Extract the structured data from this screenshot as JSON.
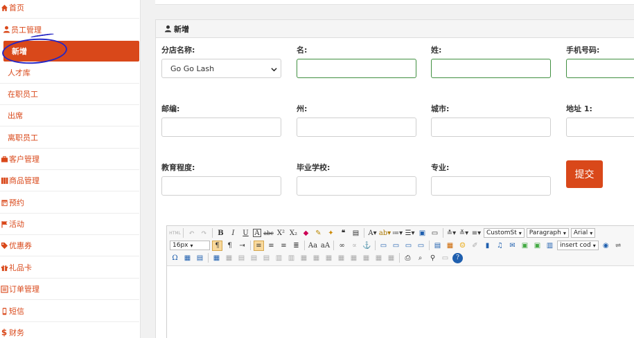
{
  "sidebar": {
    "items": [
      {
        "label": "首页",
        "icon": "home-icon"
      },
      {
        "label": "员工管理",
        "icon": "user-icon",
        "children": [
          {
            "label": "新增",
            "active": true
          },
          {
            "label": "人才库"
          },
          {
            "label": "在职员工"
          },
          {
            "label": "出席"
          },
          {
            "label": "离职员工"
          }
        ]
      },
      {
        "label": "客户管理",
        "icon": "briefcase-icon"
      },
      {
        "label": "商品管理",
        "icon": "grid-icon"
      },
      {
        "label": "预约",
        "icon": "calendar-icon"
      },
      {
        "label": "活动",
        "icon": "flag-icon"
      },
      {
        "label": "优惠券",
        "icon": "tag-icon"
      },
      {
        "label": "礼品卡",
        "icon": "gift-icon"
      },
      {
        "label": "订单管理",
        "icon": "list-icon"
      },
      {
        "label": "短信",
        "icon": "mobile-icon"
      },
      {
        "label": "财务",
        "icon": "dollar-icon"
      }
    ]
  },
  "panel": {
    "title": "新增"
  },
  "form": {
    "store_label": "分店名称:",
    "store_value": "Go Go Lash",
    "first_name_label": "名:",
    "last_name_label": "姓:",
    "phone_label": "手机号码:",
    "zip_label": "邮编:",
    "state_label": "州:",
    "city_label": "城市:",
    "address_label": "地址 1:",
    "education_label": "教育程度:",
    "school_label": "毕业学校:",
    "major_label": "专业:",
    "submit_label": "提交"
  },
  "editor": {
    "font_family_select": "CustomSt",
    "block_select": "Paragraph",
    "font_select": "Arial",
    "font_size_select": "16px",
    "insert_code_select": "insert cod"
  },
  "colors": {
    "accent": "#d9481a",
    "valid_border": "#3f8f3f",
    "annotation": "#2626c4"
  }
}
